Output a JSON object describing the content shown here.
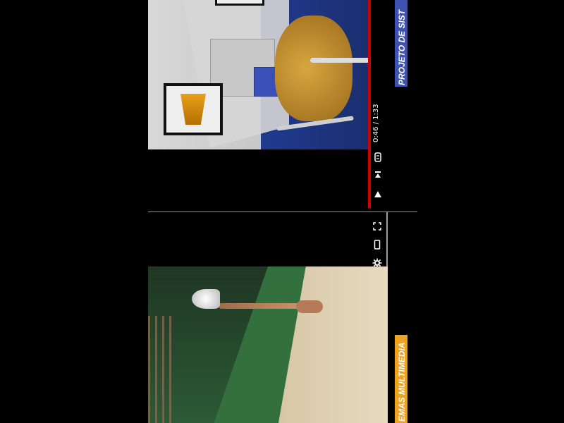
{
  "player": {
    "time_display": "0:46 / 1:33",
    "progress_ratio": 0.49
  },
  "labels": {
    "top_title": "PROJETO DE SISTEMAS MULTIMEDIA",
    "top_title_visible": "PROJETO DE SIST",
    "bottom_title_visible": "EMAS MULTIMEDIA"
  },
  "icons": {
    "cc": "cc-icon",
    "next": "next-icon",
    "play": "play-icon",
    "fullscreen": "fullscreen-icon",
    "phone": "phone-icon",
    "settings": "settings-icon"
  },
  "colors": {
    "progress": "#cc0000",
    "label_top_bg": "#3f53b3",
    "label_bottom_bg": "#f0a321"
  }
}
